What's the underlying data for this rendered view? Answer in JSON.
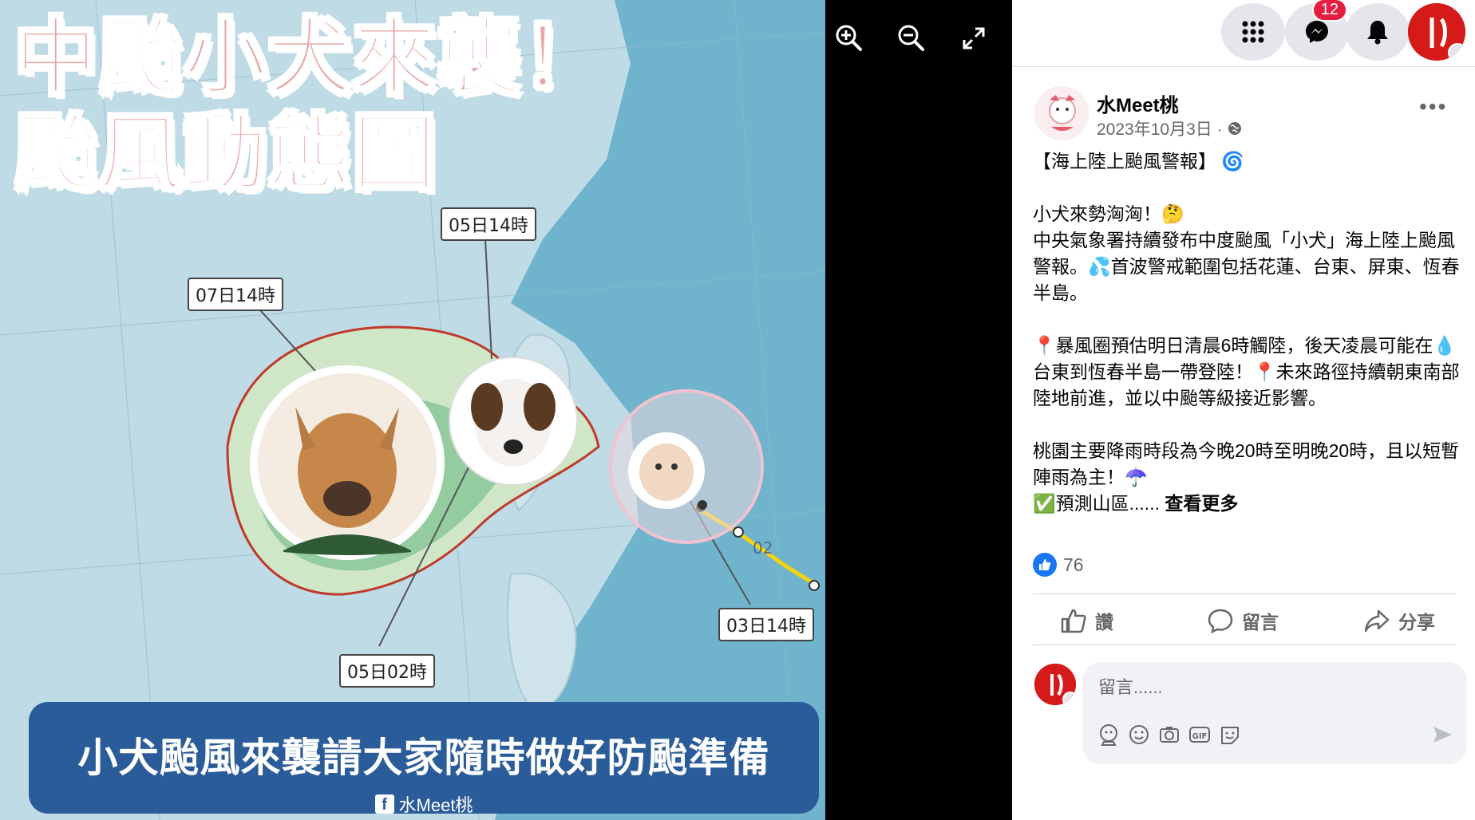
{
  "photo": {
    "headline_line1": "中颱小犬來襲！",
    "headline_line2": "颱風動態圖",
    "track_labels": [
      "05日14時",
      "07日14時",
      "05日02時",
      "03日14時"
    ],
    "track_time_marker": "02",
    "banner_text": "小犬颱風來襲請大家隨時做好防颱準備",
    "banner_credit": "水Meet桃"
  },
  "viewer": {
    "zoom_in_icon": "zoom-in-icon",
    "zoom_out_icon": "zoom-out-icon",
    "fullscreen_icon": "expand-icon"
  },
  "topbar": {
    "messenger_badge": "12"
  },
  "post": {
    "page_name": "水Meet桃",
    "date": "2023年10月3日 ·",
    "title": "【海上陸上颱風警報】",
    "p1_line1": "小犬來勢洶洶！",
    "p1_body": "中央氣象署持續發布中度颱風「小犬」海上陸上颱風警報。",
    "p1_body2": "首波警戒範圍包括花蓮、台東、屏東、恆春半島。",
    "p2_a": "暴風圈預估明日清晨6時觸陸，後天凌晨可能在",
    "p2_b": "台東到恆春半島一帶登陸！",
    "p2_c": "未來路徑持續朝東南部陸地前進，並以中颱等級接近影響。",
    "p3_a": "桃園主要降雨時段為今晚20時至明晚20時，且以短暫陣雨為主！",
    "p3_b": "預測山區......",
    "see_more": "查看更多",
    "reaction_count": "76",
    "like_label": "讚",
    "comment_label": "留言",
    "share_label": "分享",
    "comment_placeholder": "留言......",
    "comment_icon_gif": "GIF"
  },
  "colors": {
    "fb_blue": "#1877f2",
    "banner_blue": "#2b5c9a",
    "headline_pink": "#e9a7a7",
    "storm_ring": "#c0392b",
    "storm_fill": "#7cc08f"
  }
}
